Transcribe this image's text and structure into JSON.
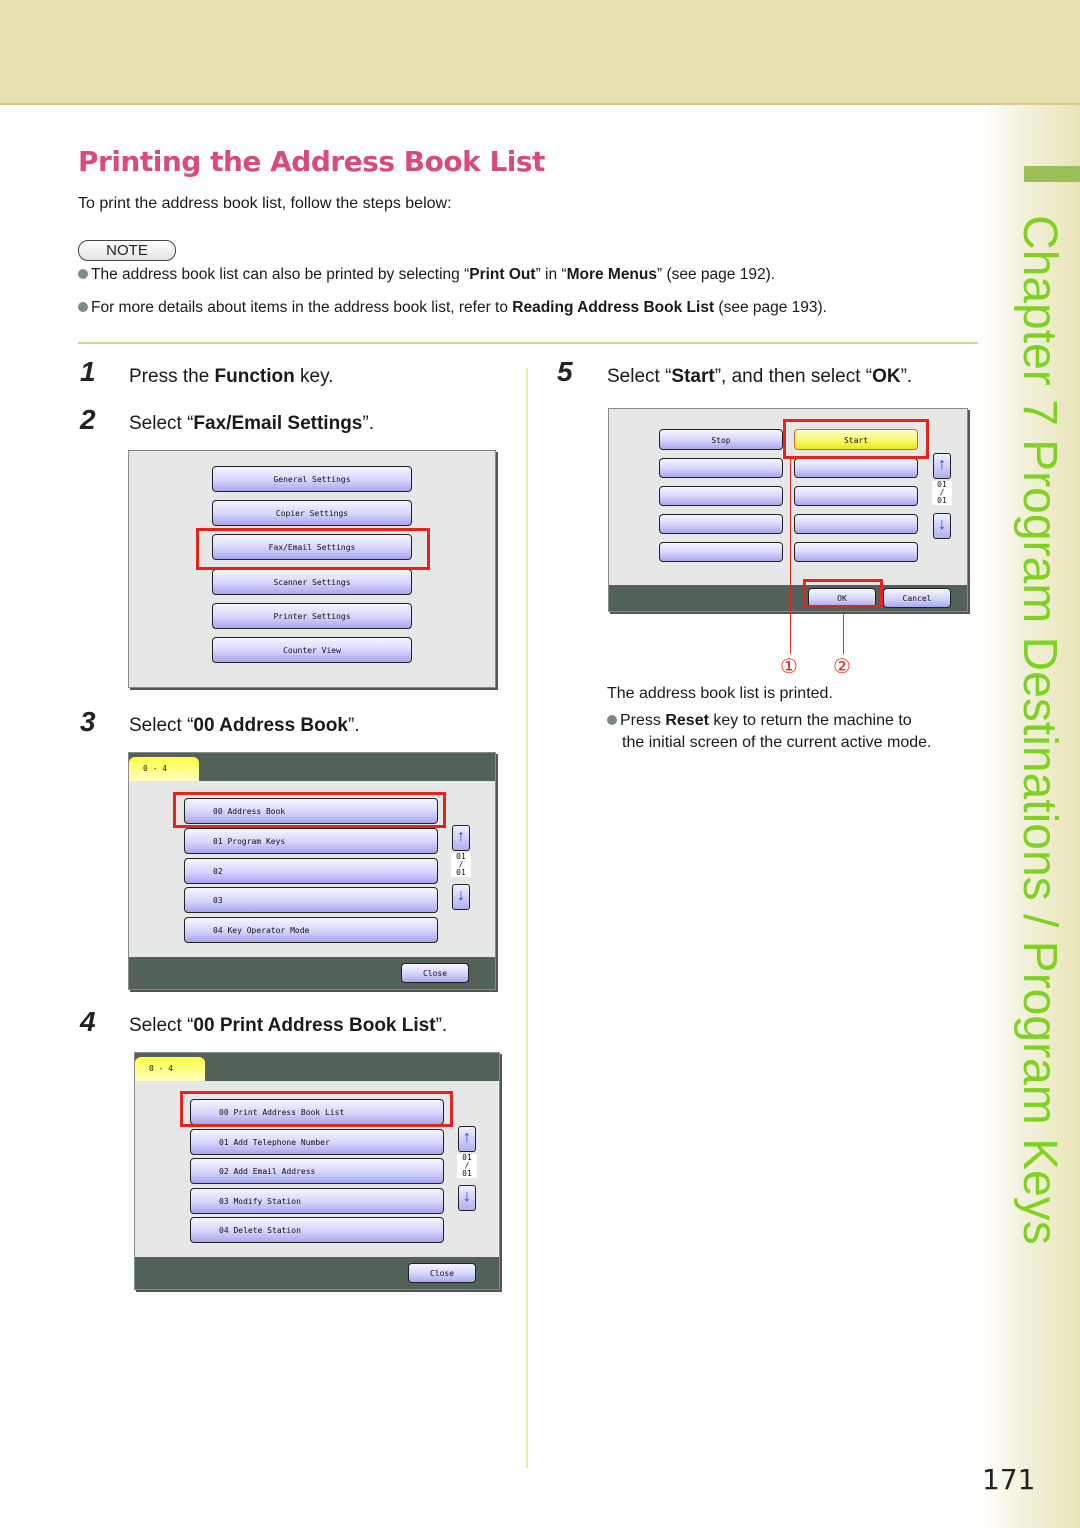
{
  "header": {
    "chapter_label": "Chapter 7   Program Destinations / Program Keys",
    "page_number": "171"
  },
  "section": {
    "title": "Printing the Address Book List",
    "intro": "To print the address book list, follow the steps below:"
  },
  "note": {
    "label": "NOTE",
    "items": [
      {
        "pre": "The address book list can also be printed by selecting “",
        "b1": "Print Out",
        "mid": "” in “",
        "b2": "More Menus",
        "post": "” (see page 192)."
      },
      {
        "pre": "For more details about items in the address book list, refer to ",
        "b1": "Reading Address Book List",
        "mid": "",
        "b2": "",
        "post": " (see page 193)."
      }
    ]
  },
  "steps": [
    {
      "num": "1",
      "pre": "Press the ",
      "bold": "Function",
      "post": " key."
    },
    {
      "num": "2",
      "pre": "Select “",
      "bold": "Fax/Email Settings",
      "post": "”."
    },
    {
      "num": "3",
      "pre": "Select “",
      "bold": "00 Address Book",
      "post": "”."
    },
    {
      "num": "4",
      "pre": "Select “",
      "bold": "00 Print Address Book List",
      "post": "”."
    },
    {
      "num": "5",
      "pre": "Select “",
      "bold": "Start",
      "mid": "”, and then select “",
      "bold2": "OK",
      "post": "”."
    }
  ],
  "screen_function": {
    "buttons": [
      "General Settings",
      "Copier Settings",
      "Fax/Email Settings",
      "Scanner Settings",
      "Printer Settings",
      "Counter View"
    ],
    "highlighted": "Fax/Email Settings"
  },
  "screen_fax_settings": {
    "tab": "0 - 4",
    "buttons": [
      "00  Address Book",
      "01  Program Keys",
      "02",
      "03",
      "04  Key Operator Mode"
    ],
    "highlighted": "00  Address Book",
    "page_indicator": {
      "current": "01",
      "sep": "/",
      "total": "01"
    },
    "close_label": "Close"
  },
  "screen_address_book": {
    "tab": "0 - 4",
    "buttons": [
      "00  Print Address Book List",
      "01  Add Telephone Number",
      "02  Add Email Address",
      "03  Modify Station",
      "04  Delete Station"
    ],
    "highlighted": "00  Print Address Book List",
    "page_indicator": {
      "current": "01",
      "sep": "/",
      "total": "01"
    },
    "close_label": "Close"
  },
  "screen_start": {
    "stop_label": "Stop",
    "start_label": "Start",
    "ok_label": "OK",
    "cancel_label": "Cancel",
    "page_indicator": {
      "current": "01",
      "sep": "/",
      "total": "01"
    },
    "callouts": [
      "①",
      "②"
    ]
  },
  "result": {
    "text": "The address book list is printed.",
    "bullet_pre": "Press ",
    "bullet_bold": "Reset",
    "bullet_post1": " key to return the machine to",
    "bullet_post2": "the initial screen of the current active mode."
  },
  "colors": {
    "title": "#d94b7d",
    "chapter": "#7ed321",
    "highlight": "#e8231a",
    "band": "#e6e2b0"
  }
}
